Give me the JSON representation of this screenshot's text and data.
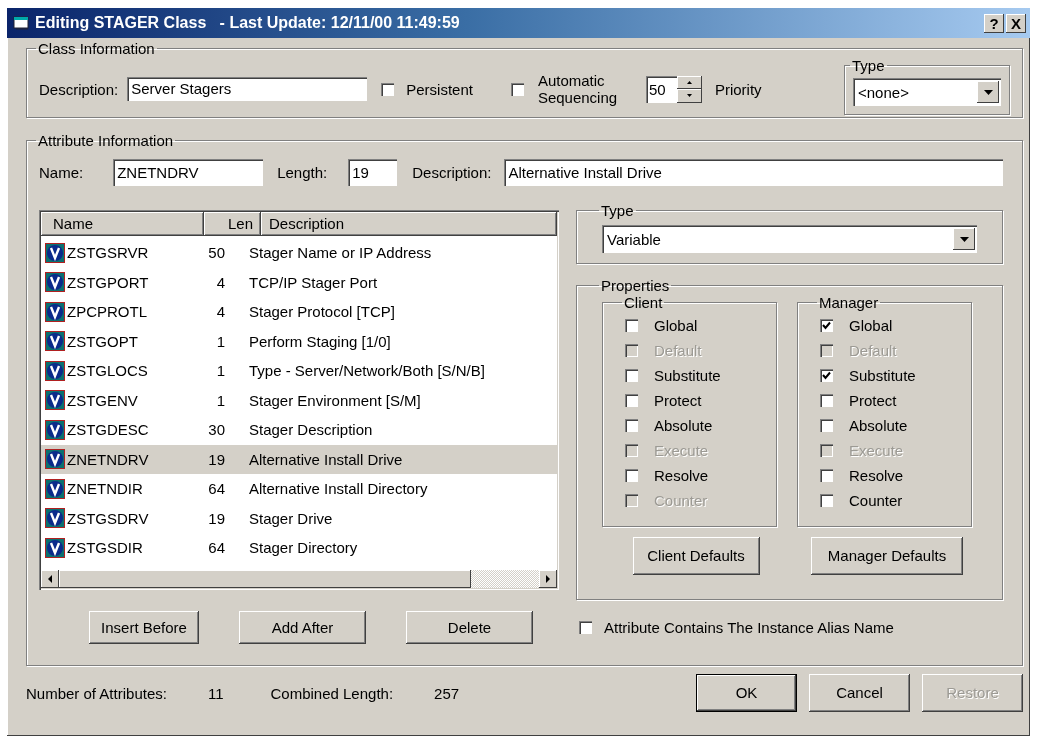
{
  "window": {
    "title": "Editing STAGER Class   - Last Update: 12/11/00 11:49:59",
    "help": "?",
    "close": "X"
  },
  "class_information": {
    "legend": "Class Information",
    "description": {
      "label": "Description:",
      "value": "Server Stagers"
    },
    "persistent": {
      "label": "Persistent",
      "checked": false
    },
    "automatic_sequencing": {
      "label": "Automatic Sequencing",
      "checked": false
    },
    "priority": {
      "value": "50",
      "label": "Priority"
    },
    "type": {
      "legend": "Type",
      "value": "<none>"
    }
  },
  "attribute_information": {
    "legend": "Attribute Information",
    "name": {
      "label": "Name:",
      "value": "ZNETNDRV"
    },
    "length": {
      "label": "Length:",
      "value": "19"
    },
    "description": {
      "label": "Description:",
      "value": "Alternative Install Drive"
    },
    "table": {
      "columns": [
        "Name",
        "Len",
        "Description"
      ],
      "rows": [
        {
          "name": "ZSTGSRVR",
          "len": "50",
          "description": "Stager Name or IP Address",
          "selected": false
        },
        {
          "name": "ZSTGPORT",
          "len": "4",
          "description": "TCP/IP Stager Port",
          "selected": false
        },
        {
          "name": "ZPCPROTL",
          "len": "4",
          "description": "Stager Protocol [TCP]",
          "selected": false
        },
        {
          "name": "ZSTGOPT",
          "len": "1",
          "description": "Perform Staging [1/0]",
          "selected": false
        },
        {
          "name": "ZSTGLOCS",
          "len": "1",
          "description": "Type - Server/Network/Both [S/N/B]",
          "selected": false
        },
        {
          "name": "ZSTGENV",
          "len": "1",
          "description": "Stager Environment [S/M]",
          "selected": false
        },
        {
          "name": "ZSTGDESC",
          "len": "30",
          "description": "Stager Description",
          "selected": false
        },
        {
          "name": "ZNETNDRV",
          "len": "19",
          "description": "Alternative Install Drive",
          "selected": true
        },
        {
          "name": "ZNETNDIR",
          "len": "64",
          "description": "Alternative Install Directory",
          "selected": false
        },
        {
          "name": "ZSTGSDRV",
          "len": "19",
          "description": "Stager Drive",
          "selected": false
        },
        {
          "name": "ZSTGSDIR",
          "len": "64",
          "description": "Stager Directory",
          "selected": false
        }
      ]
    },
    "list_buttons": [
      "Insert Before",
      "Add After",
      "Delete"
    ],
    "type": {
      "legend": "Type",
      "value": "Variable"
    },
    "properties": {
      "legend": "Properties",
      "groups": [
        {
          "legend": "Client",
          "options": [
            {
              "label": "Global",
              "checked": false,
              "disabled": false
            },
            {
              "label": "Default",
              "checked": false,
              "disabled": true
            },
            {
              "label": "Substitute",
              "checked": false,
              "disabled": false
            },
            {
              "label": "Protect",
              "checked": false,
              "disabled": false
            },
            {
              "label": "Absolute",
              "checked": false,
              "disabled": false
            },
            {
              "label": "Execute",
              "checked": false,
              "disabled": true
            },
            {
              "label": "Resolve",
              "checked": false,
              "disabled": false
            },
            {
              "label": "Counter",
              "checked": false,
              "disabled": true
            }
          ],
          "button": "Client Defaults"
        },
        {
          "legend": "Manager",
          "options": [
            {
              "label": "Global",
              "checked": true,
              "disabled": false
            },
            {
              "label": "Default",
              "checked": false,
              "disabled": true
            },
            {
              "label": "Substitute",
              "checked": true,
              "disabled": false
            },
            {
              "label": "Protect",
              "checked": false,
              "disabled": false
            },
            {
              "label": "Absolute",
              "checked": false,
              "disabled": false
            },
            {
              "label": "Execute",
              "checked": false,
              "disabled": true
            },
            {
              "label": "Resolve",
              "checked": false,
              "disabled": false
            },
            {
              "label": "Counter",
              "checked": false,
              "disabled": false
            }
          ],
          "button": "Manager Defaults"
        }
      ]
    },
    "alias": {
      "label": "Attribute Contains The Instance Alias Name",
      "checked": false
    }
  },
  "status": {
    "count_label": "Number of Attributes:",
    "count": "11",
    "length_label": "Combined Length:",
    "length": "257"
  },
  "buttons": [
    {
      "label": "OK",
      "disabled": false,
      "default": true
    },
    {
      "label": "Cancel",
      "disabled": false,
      "default": false
    },
    {
      "label": "Restore",
      "disabled": true,
      "default": false
    }
  ]
}
